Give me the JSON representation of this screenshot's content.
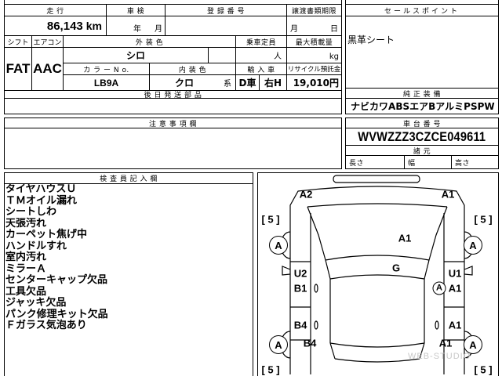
{
  "header": {
    "mileage_label": "走 行",
    "inspection_label": "車 検",
    "registration_label": "登 録 番 号",
    "transfer_deadline_label": "譲渡書類期限"
  },
  "values": {
    "mileage": "86,143",
    "mileage_unit": "km",
    "inspection_year_unit": "年",
    "inspection_month_unit": "月",
    "deadline_month_unit": "月",
    "deadline_day_unit": "日"
  },
  "specs": {
    "shift_label": "シフト",
    "aircon_label": "エアコン",
    "exterior_color_label": "外 装 色",
    "capacity_label": "乗車定員",
    "max_load_label": "最大積載量",
    "shift_value": "FAT",
    "aircon_value": "AAC",
    "exterior_color_value": "シロ",
    "capacity_unit": "人",
    "max_load_unit": "kg",
    "color_no_label": "カ ラ ー N o.",
    "interior_color_label": "内 装 色",
    "import_label": "輸 入 車",
    "recycle_label": "リサイクル預託金",
    "color_no_value": "LB9A",
    "interior_color_value": "クロ",
    "interior_color_suffix": "系",
    "import_dealer": "D車",
    "steering": "右H",
    "recycle_value": "19,010円"
  },
  "parts_label": "後 日 発 送 部 品",
  "sales_points": {
    "label": "セールスポイント",
    "text": "黒革シート"
  },
  "equipment": {
    "label": "純 正 装 備",
    "items": [
      "ナビ",
      "カワ",
      "ABS",
      "エアB",
      "アルミ",
      "PS",
      "PW"
    ]
  },
  "notes_label": "注 意 事 項 欄",
  "chassis": {
    "label": "車 台 番 号",
    "value": "WVWZZZ3CZCE049611",
    "specs_label": "諸 元",
    "length_label": "長さ",
    "width_label": "幅",
    "height_label": "高さ"
  },
  "inspector": {
    "label": "検 査 員 記 入 欄",
    "comments": [
      "タイヤハウスＵ",
      "ＴＭオイル漏れ",
      "シートしわ",
      "天張汚れ",
      "カーペット焦げ中",
      "ハンドルすれ",
      "室内汚れ",
      "ミラーＡ",
      "センターキャップ欠品",
      "工具欠品",
      "ジャッキ欠品",
      "パンク修理キット欠品",
      "Ｆガラス気泡あり"
    ]
  },
  "diagram": {
    "marks": [
      "A2",
      "A1",
      "[ 5 ]",
      "[ 5 ]",
      "A1",
      "A",
      "A",
      "G",
      "U2",
      "U1",
      "B1",
      "A",
      "A1",
      "B4",
      "A1",
      "B4",
      "A1",
      "A",
      "A",
      "[ 5 ]",
      "[ 5 ]"
    ]
  },
  "watermark": "WEB-STUDIO"
}
